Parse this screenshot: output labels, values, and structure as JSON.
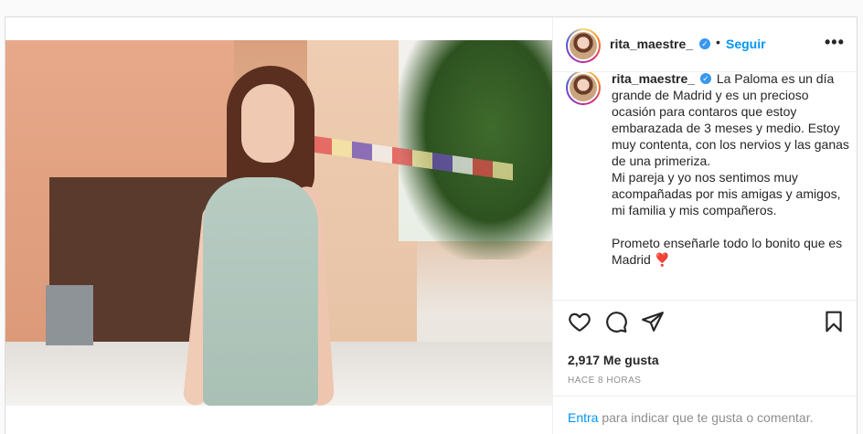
{
  "post": {
    "username": "rita_maestre_",
    "verified_badge": "✓",
    "separator": "•",
    "follow_label": "Seguir",
    "more_label": "•••",
    "caption": "La Paloma es un día grande de Madrid y es un precioso ocasión para contaros que estoy embarazada de 3 meses y medio. Estoy muy contenta, con los nervios y las ganas de una primeriza.\nMi pareja y yo nos sentimos muy acompañadas por mis amigas y amigos, mi familia y mis compañeros.\n\nPrometo enseñarle todo lo bonito que es Madrid ❣️",
    "likes_text": "2,917 Me gusta",
    "timestamp": "HACE 8 HORAS",
    "login_link": "Entra",
    "login_prompt": " para indicar que te gusta o comentar.",
    "icons": {
      "like": "heart-icon",
      "comment": "comment-icon",
      "share": "share-icon",
      "save": "bookmark-icon"
    },
    "colors": {
      "accent": "#0095f6",
      "verified": "#3897f0",
      "text": "#262626",
      "muted": "#8e8e8e"
    }
  }
}
